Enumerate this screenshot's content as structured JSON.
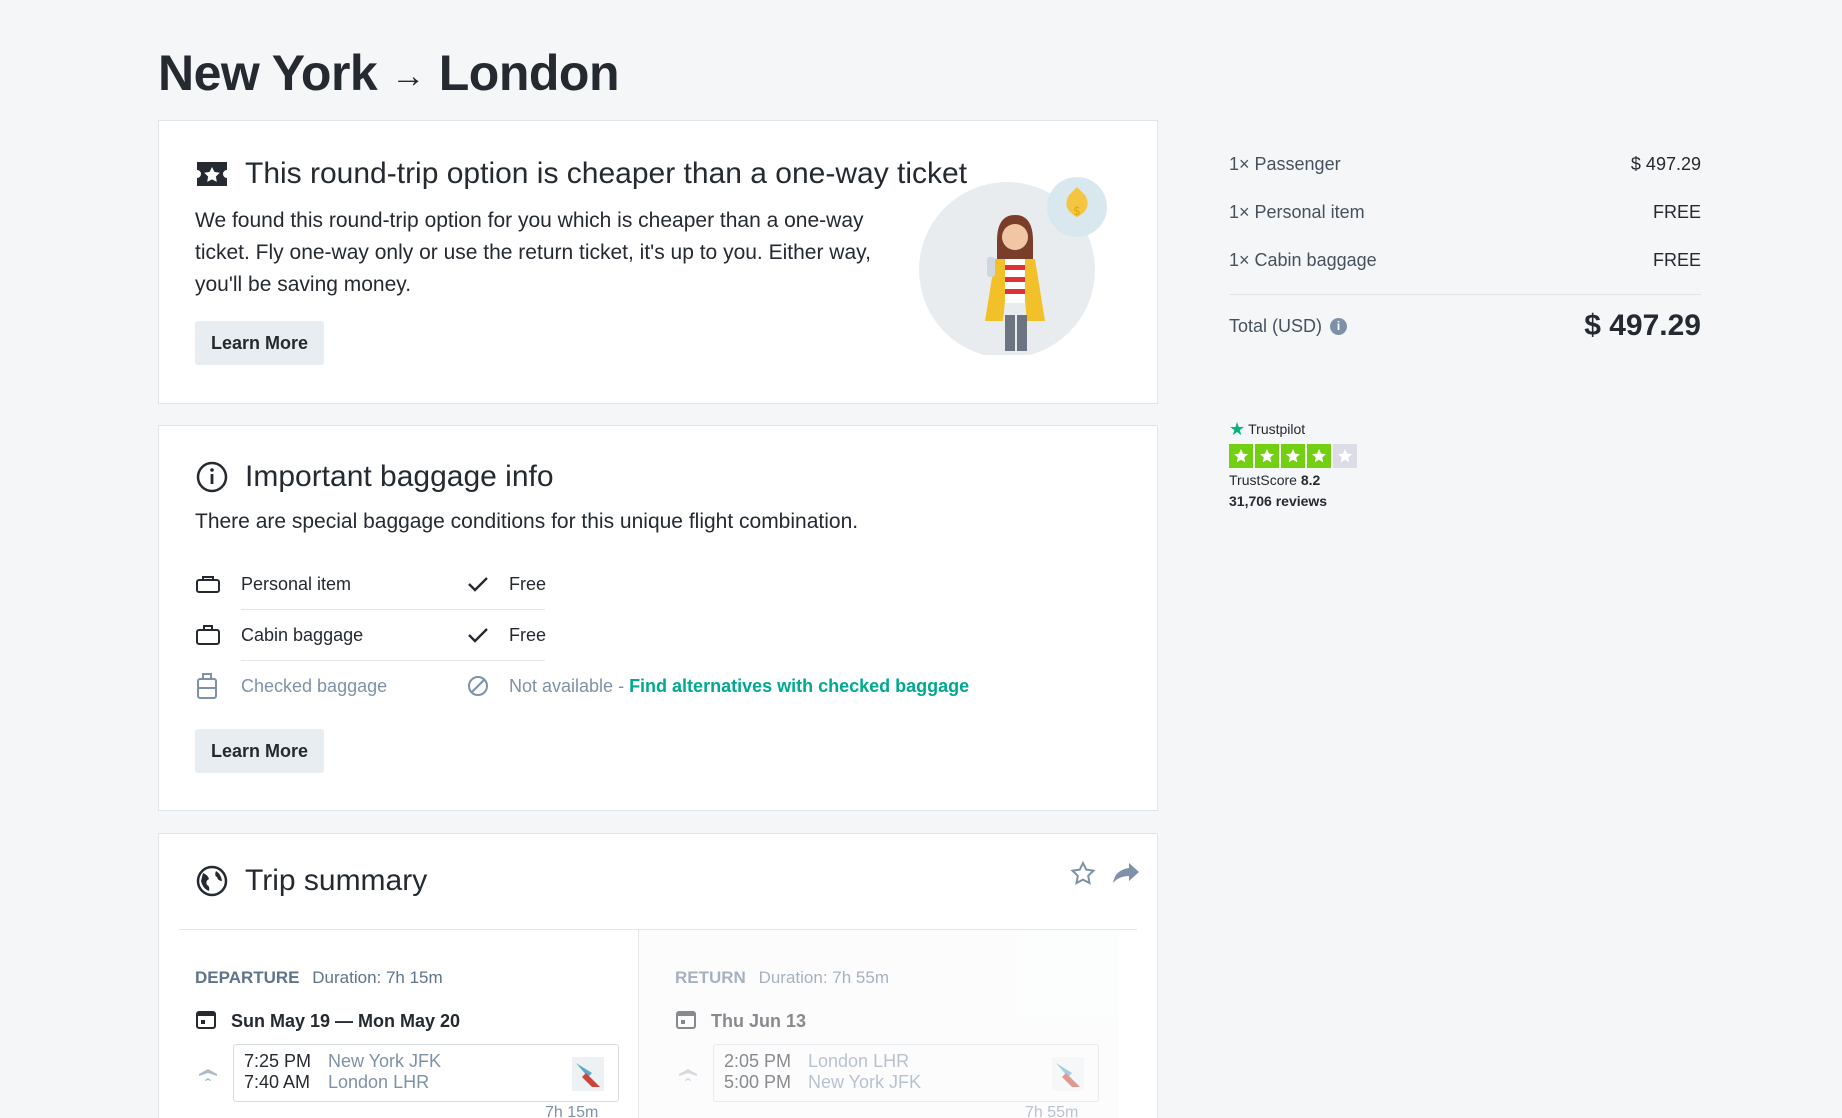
{
  "page": {
    "origin": "New York",
    "arrow": "→",
    "destination": "London"
  },
  "offer": {
    "title": "This round-trip option is cheaper than a one-way ticket",
    "body_line1": "We found this round-trip option for you which is cheaper than a one-way",
    "body_line2": "ticket. Fly one-way only or use the return ticket, it's up to you. Either way,",
    "body_line3": "you'll be saving money.",
    "button": "Learn More",
    "icon": "ticket-star-icon"
  },
  "baggage": {
    "title": "Important baggage info",
    "subtitle": "There are special baggage conditions for this unique flight combination.",
    "items": [
      {
        "label": "Personal item",
        "status": "Free",
        "icon": "personal-item-icon"
      },
      {
        "label": "Cabin baggage",
        "status": "Free",
        "icon": "cabin-bag-icon"
      },
      {
        "label": "Checked baggage",
        "status": "Not available",
        "link": "Find alternatives with checked baggage",
        "icon": "checked-bag-icon"
      }
    ],
    "link_prefix": " - ",
    "button": "Learn More"
  },
  "trip": {
    "title": "Trip summary",
    "departure": {
      "label": "DEPARTURE",
      "duration": "Duration: 7h 15m",
      "dates": "Sun May 19 — Mon May 20",
      "dep_time": "7:25 PM",
      "dep_place": "New York JFK",
      "arr_time": "7:40 AM",
      "arr_place": "London LHR",
      "seg_duration": "7h 15m"
    },
    "return": {
      "label": "RETURN",
      "duration": "Duration: 7h 55m",
      "dates": "Thu Jun 13",
      "dep_time": "2:05 PM",
      "dep_place": "London LHR",
      "arr_time": "5:00 PM",
      "arr_place": "New York JFK",
      "seg_duration": "7h 55m"
    }
  },
  "summary": {
    "rows": [
      {
        "label": "1× Passenger",
        "value": "$ 497.29"
      },
      {
        "label": "1× Personal item",
        "value": "FREE"
      },
      {
        "label": "1× Cabin baggage",
        "value": "FREE"
      }
    ],
    "total_label": "Total (USD)",
    "total_value": "$ 497.29"
  },
  "trustpilot": {
    "brand": "Trustpilot",
    "score_label": "TrustScore",
    "score": "8.2",
    "reviews": "31,706 reviews",
    "stars_filled": 4,
    "stars_total": 5
  },
  "colors": {
    "accent_green": "#00a991",
    "trustpilot_green": "#73cf11",
    "text_primary": "#252a31",
    "text_muted": "#7f91a8"
  }
}
